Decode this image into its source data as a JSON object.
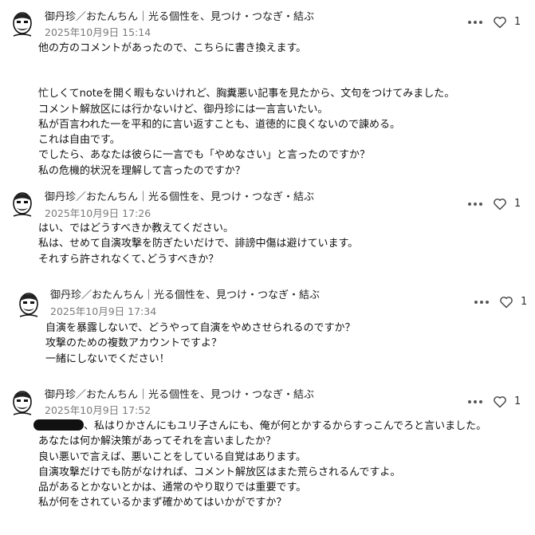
{
  "comments": [
    {
      "author": "御丹珍／おたんちん｜光る個性を、見つけ・つなぎ・結ぶ",
      "date": "2025年10月9日 15:14",
      "likes": "1",
      "intro": "他の方のコメントがあったので、こちらに書き換えます。",
      "lines": [
        "忙しくてnoteを開く暇もないけれど、胸糞悪い記事を見たから、文句をつけてみました。",
        "コメント解放区には行かないけど、御丹珍には一言言いたい。",
        "私が百言われた一を平和的に言い返すことも、道徳的に良くないので諌める。",
        "これは自由です。",
        "でしたら、あなたは彼らに一言でも「やめなさい」と言ったのですか？",
        "私の危機的状況を理解して言ったのですか？"
      ]
    },
    {
      "author": "御丹珍／おたんちん｜光る個性を、見つけ・つなぎ・結ぶ",
      "date": "2025年10月9日 17:26",
      "likes": "1",
      "lines": [
        "はい、ではどうすべきか教えてください。",
        "私は、せめて自演攻撃を防ぎたいだけで、誹謗中傷は避けています。",
        "それすら許されなくて､どうすべきか？"
      ]
    },
    {
      "author": "御丹珍／おたんちん｜光る個性を、見つけ・つなぎ・結ぶ",
      "date": "2025年10月9日 17:34",
      "likes": "1",
      "lines": [
        "自演を暴露しないで、どうやって自演をやめさせられるのですか？",
        "攻撃のための複数アカウントですよ？",
        "一緒にしないでください！"
      ]
    },
    {
      "author": "御丹珍／おたんちん｜光る個性を、見つけ・つなぎ・結ぶ",
      "date": "2025年10月9日 17:52",
      "likes": "1",
      "first_line_rest": "、私はりかさんにもユリ子さんにも、俺が何とかするからすっこんでろと言いました。",
      "lines": [
        "あなたは何か解決策があってそれを言いましたか？",
        "良い悪いで言えば、悪いことをしている自覚はあります。",
        "自演攻撃だけでも防がなければ、コメント解放区はまた荒らされるんですよ。",
        "品があるとかないとかは、通常のやり取りでは重要です。",
        "私が何をされているかまず確かめてはいかがですか？"
      ]
    }
  ]
}
